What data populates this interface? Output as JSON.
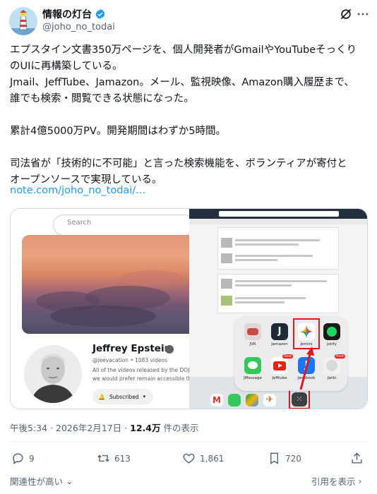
{
  "author": {
    "display_name": "情報の灯台",
    "handle": "@joho_no_todai"
  },
  "tweet": {
    "lines": [
      "エプスタイン文書350万ページを、個人開発者がGmailやYouTubeそっくり",
      "のUIに再構築している。",
      "Jmail、JeffTube、Jamazon。メール、監視映像、Amazon購入履歴まで、",
      "誰でも検索・閲覧できる状態になった。",
      "",
      "累計4億5000万PV。開発期間はわずか5時間。",
      "",
      "司法省が「技術的に不可能」と言った検索機能を、ボランティアが寄付と",
      "オープンソースで実現している。"
    ],
    "link": "note.com/joho_no_todai/..."
  },
  "media": {
    "left": {
      "search_placeholder": "Search",
      "channel_name": "Jeffrey Epstein",
      "channel_meta": "@jeevacation • 1083 videos",
      "desc_line1": "All of the videos released by the DOJ fro",
      "desc_line2": "we would prefer remain accessible throu",
      "subscribed_label": "Subscribed"
    },
    "right": {
      "apps": [
        {
          "label": "JVR",
          "color": "#c94a46"
        },
        {
          "label": "Jamazon",
          "color": "#1f2937"
        },
        {
          "label": "Jemini",
          "color": "#ffffff"
        },
        {
          "label": "Jotify",
          "color": "#1a1a1a"
        },
        {
          "label": "JMessage",
          "color": "#34c759"
        },
        {
          "label": "Jefftube",
          "color": "#e62117"
        },
        {
          "label": "Jacebook",
          "color": "#1877f2"
        },
        {
          "label": "Jwiki",
          "color": "#f2f2f2"
        }
      ],
      "new_badge": "New"
    }
  },
  "meta": {
    "time": "午後5:34",
    "date": "2026年2月17日",
    "views": "12.4万",
    "views_suffix": "件の表示"
  },
  "actions": {
    "replies": "9",
    "reposts": "613",
    "likes": "1,861",
    "bookmarks": "720"
  },
  "footer": {
    "relevance": "関連性が高い",
    "quotes": "引用を表示"
  },
  "colors": {
    "link": "#1d9bf0",
    "secondary": "#536471",
    "verified": "#1d9bf0",
    "highlight": "#e0181b"
  }
}
